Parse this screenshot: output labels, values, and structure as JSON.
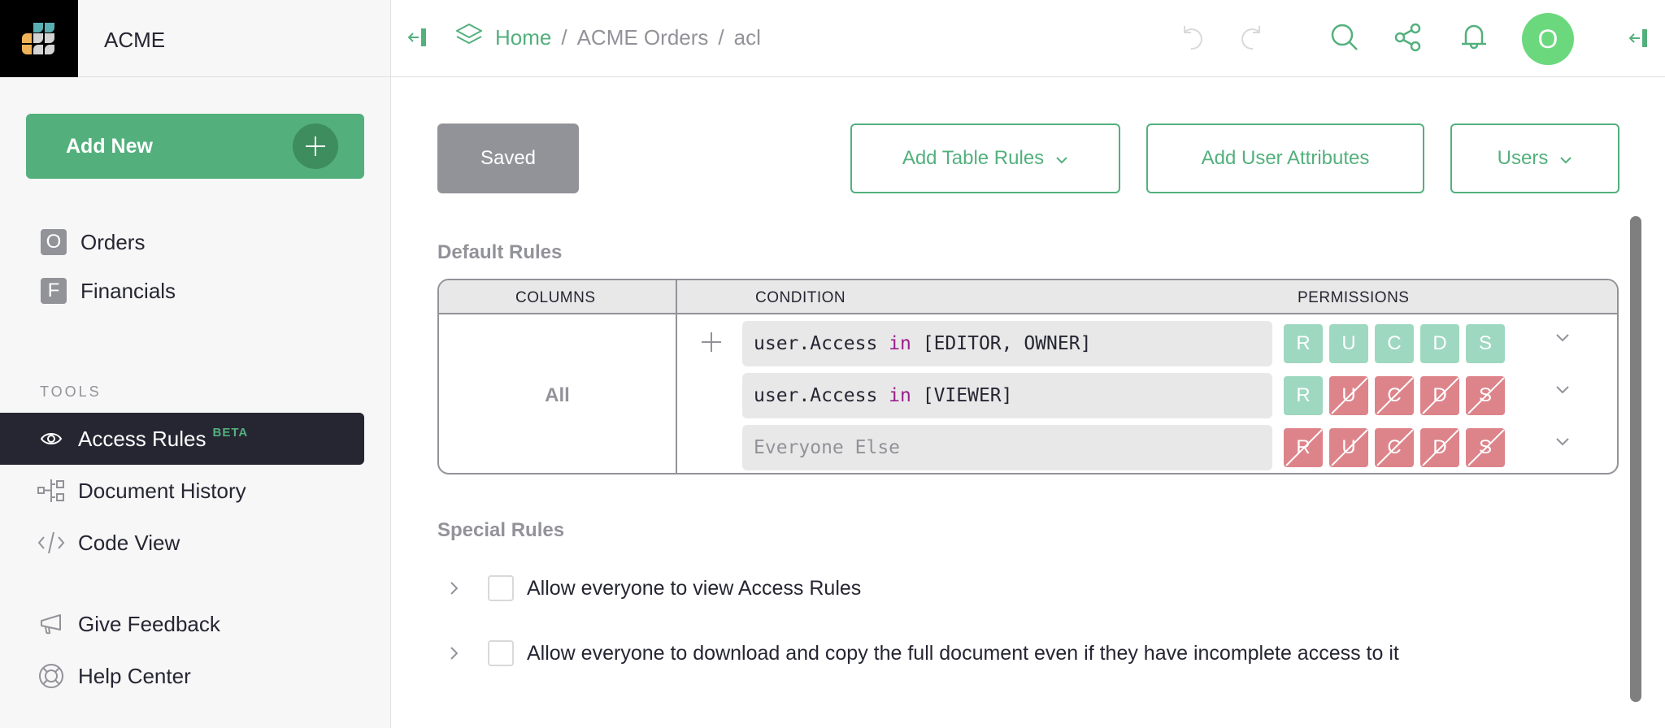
{
  "org": {
    "name": "ACME"
  },
  "sidebar": {
    "add_new_label": "Add New",
    "pages": [
      {
        "badge": "O",
        "label": "Orders"
      },
      {
        "badge": "F",
        "label": "Financials"
      }
    ],
    "tools_header": "TOOLS",
    "tools": [
      {
        "icon": "eye-icon",
        "label": "Access Rules",
        "badge": "BETA",
        "active": true
      },
      {
        "icon": "document-history-icon",
        "label": "Document History"
      },
      {
        "icon": "code-icon",
        "label": "Code View"
      }
    ],
    "footer": [
      {
        "icon": "megaphone-icon",
        "label": "Give Feedback"
      },
      {
        "icon": "lifebuoy-icon",
        "label": "Help Center"
      }
    ]
  },
  "topbar": {
    "breadcrumb": {
      "home": "Home",
      "sep": "/",
      "doc": "ACME Orders",
      "page": "acl"
    },
    "avatar_initial": "O",
    "icons": [
      "undo-icon",
      "redo-icon",
      "search-icon",
      "share-icon",
      "bell-icon"
    ]
  },
  "toolbar": {
    "saved_label": "Saved",
    "add_table_rules_label": "Add Table Rules",
    "add_user_attributes_label": "Add User Attributes",
    "users_label": "Users"
  },
  "default_rules": {
    "title": "Default Rules",
    "headers": {
      "columns": "COLUMNS",
      "condition": "CONDITION",
      "permissions": "PERMISSIONS"
    },
    "columns_value": "All",
    "rules": [
      {
        "condition_prefix": "user.Access ",
        "condition_keyword": "in",
        "condition_suffix": " [EDITOR, OWNER]",
        "permissions": [
          {
            "letter": "R",
            "state": "allow"
          },
          {
            "letter": "U",
            "state": "allow"
          },
          {
            "letter": "C",
            "state": "allow"
          },
          {
            "letter": "D",
            "state": "allow"
          },
          {
            "letter": "S",
            "state": "allow"
          }
        ]
      },
      {
        "condition_prefix": "user.Access ",
        "condition_keyword": "in",
        "condition_suffix": " [VIEWER]",
        "permissions": [
          {
            "letter": "R",
            "state": "allow"
          },
          {
            "letter": "U",
            "state": "deny"
          },
          {
            "letter": "C",
            "state": "deny"
          },
          {
            "letter": "D",
            "state": "deny"
          },
          {
            "letter": "S",
            "state": "deny"
          }
        ]
      },
      {
        "placeholder": "Everyone Else",
        "permissions": [
          {
            "letter": "R",
            "state": "deny"
          },
          {
            "letter": "U",
            "state": "deny"
          },
          {
            "letter": "C",
            "state": "deny"
          },
          {
            "letter": "D",
            "state": "deny"
          },
          {
            "letter": "S",
            "state": "deny"
          }
        ]
      }
    ]
  },
  "special_rules": {
    "title": "Special Rules",
    "items": [
      {
        "label": "Allow everyone to view Access Rules",
        "checked": false
      },
      {
        "label": "Allow everyone to download and copy the full document even if they have incomplete access to it",
        "checked": false
      }
    ]
  },
  "colors": {
    "accent": "#53b07d",
    "allow": "#9ed8c0",
    "deny": "#dd848b",
    "active_nav": "#262633",
    "avatar": "#6bd87e"
  }
}
